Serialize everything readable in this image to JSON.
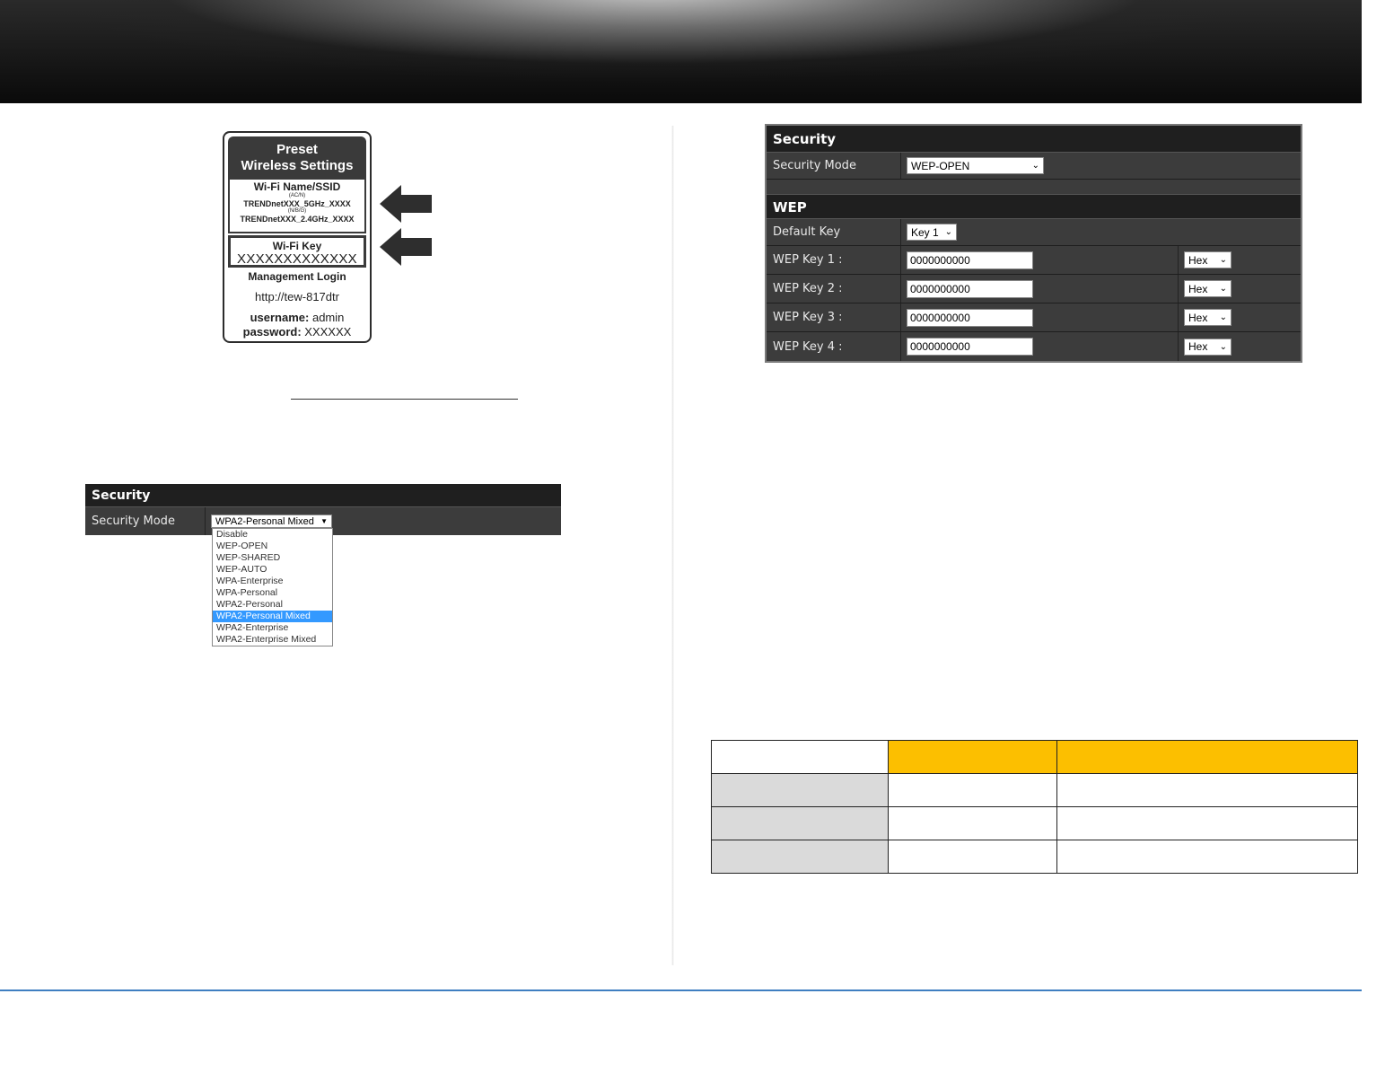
{
  "label_card": {
    "title": "Preset\nWireless Settings",
    "ssid_title": "Wi-Fi Name/SSID",
    "band_ac": "(AC/N)",
    "ssid_5g": "TRENDnetXXX_5GHz_XXXX",
    "band_ng": "(N/B/G)",
    "ssid_24g": "TRENDnetXXX_2.4GHz_XXXX",
    "key_title": "Wi-Fi Key",
    "key_value": "XXXXXXXXXXXXX",
    "login_title": "Management Login",
    "login_url": "http://tew-817dtr",
    "username_label": "username:",
    "username_value": "admin",
    "password_label": "password:",
    "password_value": "XXXXXX"
  },
  "security_panel_small": {
    "title": "Security",
    "mode_label": "Security Mode",
    "mode_value": "WPA2-Personal Mixed",
    "options": [
      "Disable",
      "WEP-OPEN",
      "WEP-SHARED",
      "WEP-AUTO",
      "WPA-Enterprise",
      "WPA-Personal",
      "WPA2-Personal",
      "WPA2-Personal Mixed",
      "WPA2-Enterprise",
      "WPA2-Enterprise Mixed"
    ],
    "highlighted_option": "WPA2-Personal Mixed"
  },
  "security_panel_large": {
    "title": "Security",
    "mode_label": "Security Mode",
    "mode_value": "WEP-OPEN",
    "wep_title": "WEP",
    "default_key_label": "Default Key",
    "default_key_value": "Key 1",
    "keys": [
      {
        "label": "WEP Key 1 :",
        "value": "0000000000",
        "format": "Hex"
      },
      {
        "label": "WEP Key 2 :",
        "value": "0000000000",
        "format": "Hex"
      },
      {
        "label": "WEP Key 3 :",
        "value": "0000000000",
        "format": "Hex"
      },
      {
        "label": "WEP Key 4 :",
        "value": "0000000000",
        "format": "Hex"
      }
    ]
  },
  "colors": {
    "table_header_accent": "#fcbf00",
    "table_row_label_bg": "#dadada",
    "footer_line": "#3f7fc1",
    "dropdown_highlight": "#3399ff"
  }
}
